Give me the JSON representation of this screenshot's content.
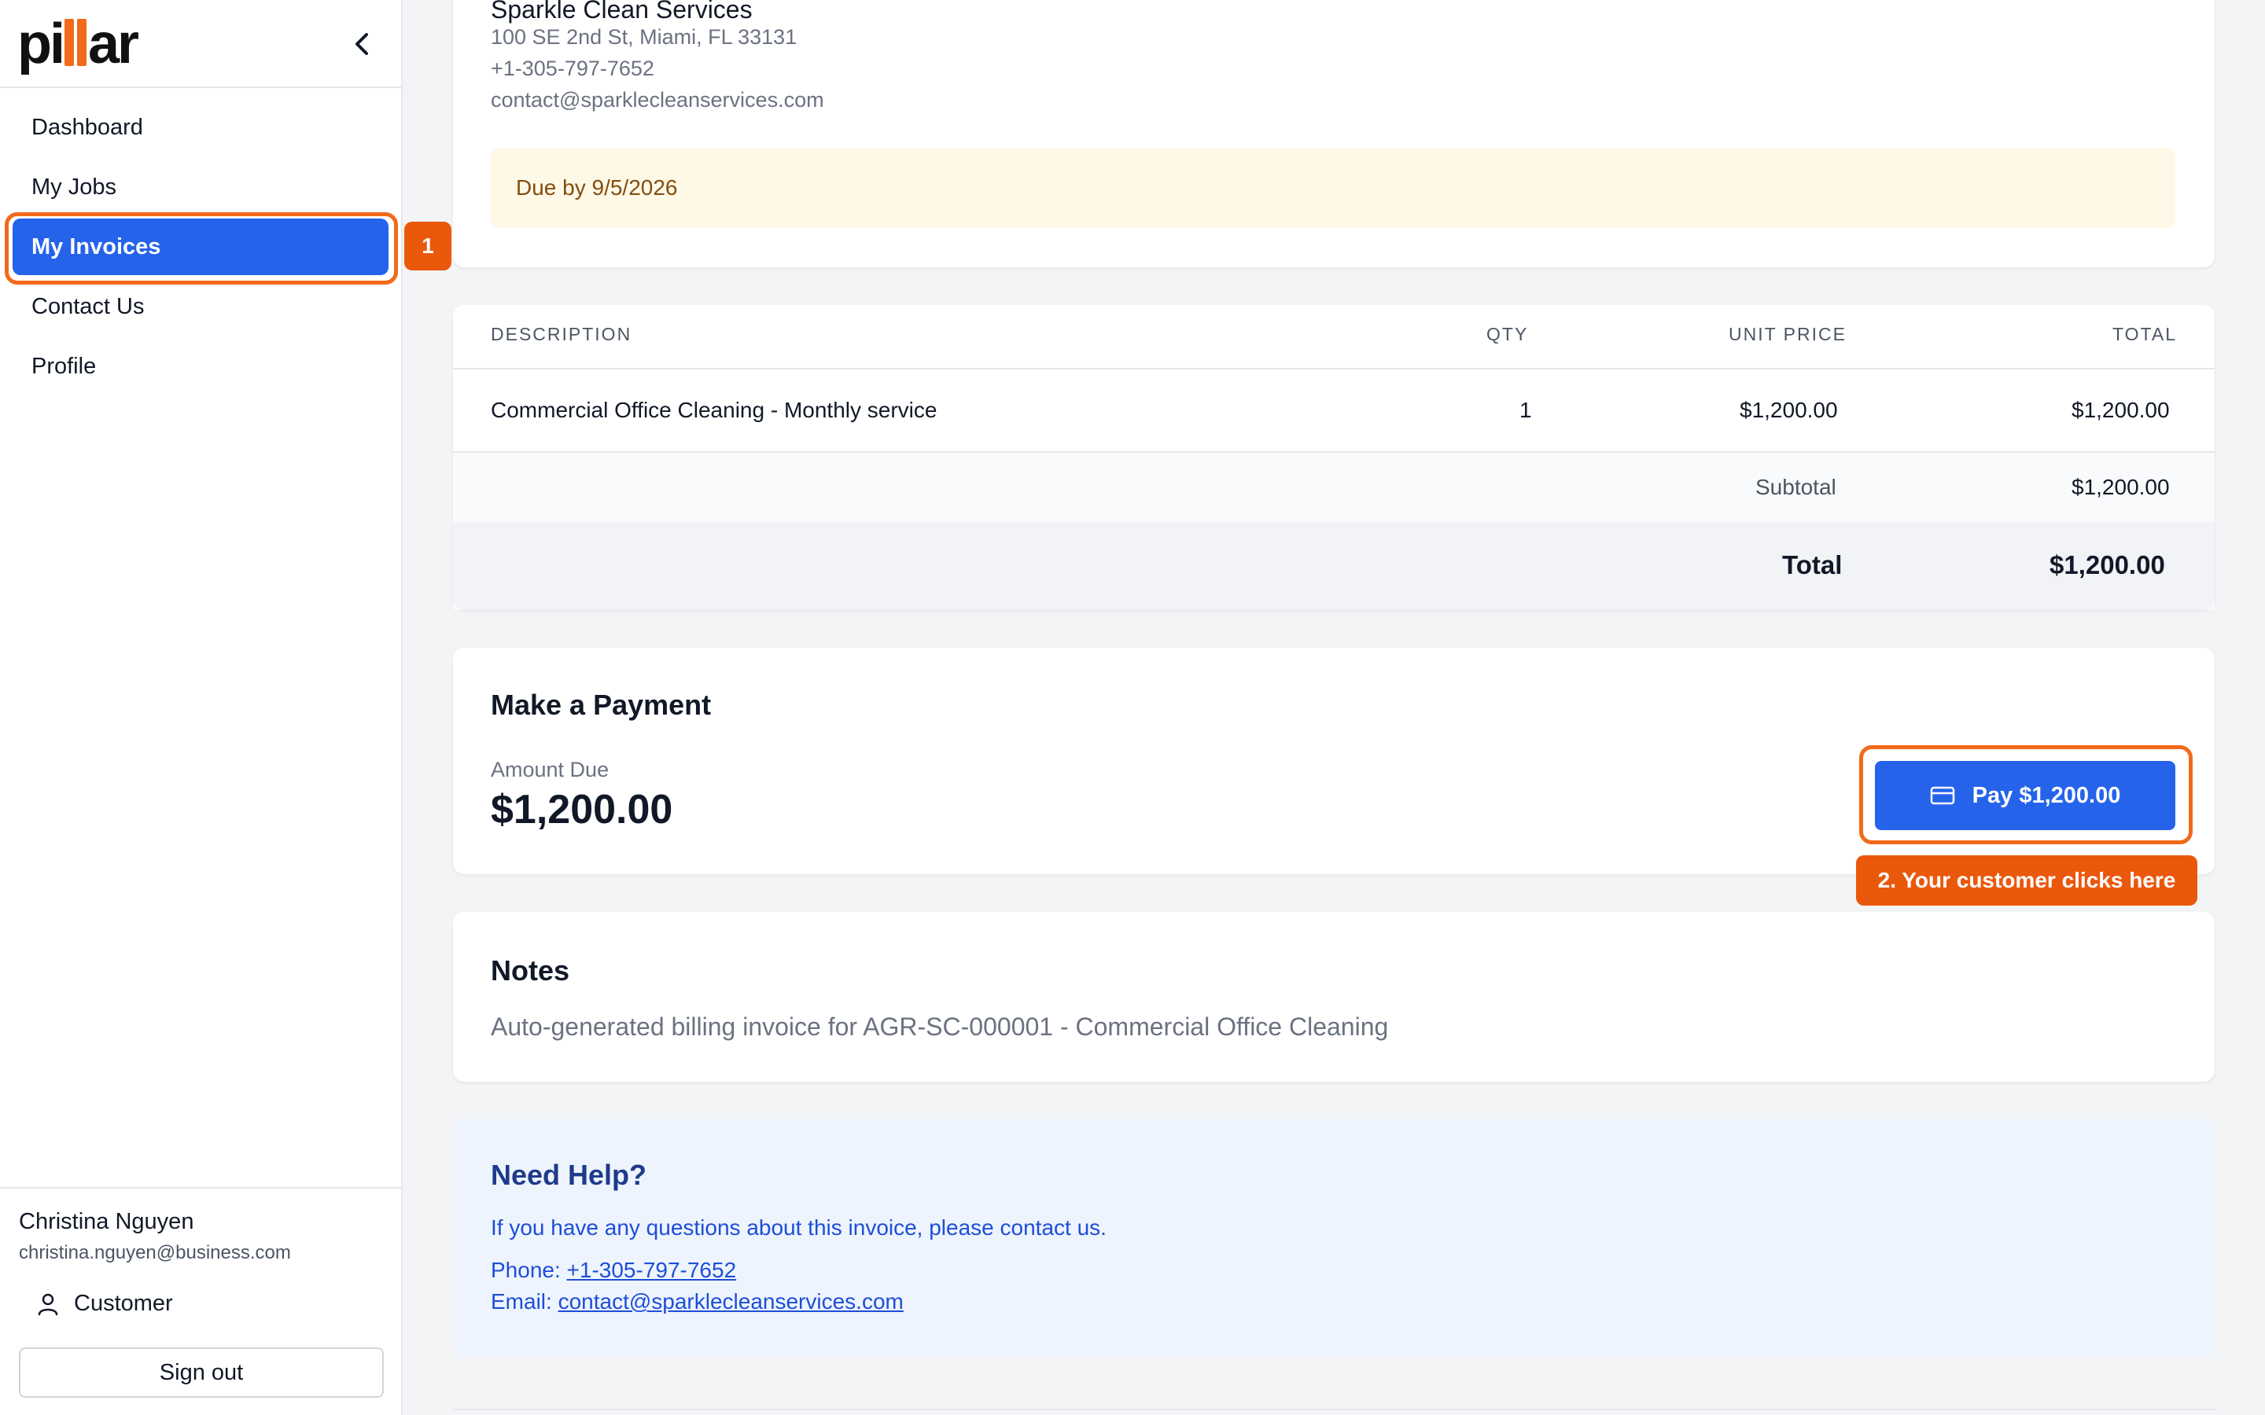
{
  "brand": {
    "logo_text_left": "pi",
    "logo_text_right": "ar"
  },
  "sidebar": {
    "items": [
      {
        "label": "Dashboard"
      },
      {
        "label": "My Jobs"
      },
      {
        "label": "My Invoices"
      },
      {
        "label": "Contact Us"
      },
      {
        "label": "Profile"
      }
    ],
    "active_index": 2
  },
  "user": {
    "name": "Christina Nguyen",
    "email": "christina.nguyen@business.com",
    "role": "Customer",
    "signout_label": "Sign out"
  },
  "company": {
    "name": "Sparkle Clean Services",
    "address": "100 SE 2nd St, Miami, FL 33131",
    "phone": "+1-305-797-7652",
    "email": "contact@sparklecleanservices.com"
  },
  "invoice": {
    "due_text": "Due by 9/5/2026",
    "columns": [
      "DESCRIPTION",
      "QTY",
      "UNIT PRICE",
      "TOTAL"
    ],
    "items": [
      {
        "description": "Commercial Office Cleaning - Monthly service",
        "qty": "1",
        "unit_price": "$1,200.00",
        "total": "$1,200.00"
      }
    ],
    "subtotal_label": "Subtotal",
    "subtotal": "$1,200.00",
    "total_label": "Total",
    "total": "$1,200.00"
  },
  "payment": {
    "title": "Make a Payment",
    "amount_label": "Amount Due",
    "amount": "$1,200.00",
    "button_label": "Pay $1,200.00"
  },
  "annotations": {
    "step1": "1",
    "step2": "2. Your customer clicks here",
    "accent": "#f26a1b"
  },
  "notes": {
    "title": "Notes",
    "text": "Auto-generated billing invoice for AGR-SC-000001 - Commercial Office Cleaning"
  },
  "help": {
    "title": "Need Help?",
    "text": "If you have any questions about this invoice, please contact us.",
    "phone_label": "Phone:",
    "phone": "+1-305-797-7652",
    "email_label": "Email:",
    "email": "contact@sparklecleanservices.com"
  }
}
